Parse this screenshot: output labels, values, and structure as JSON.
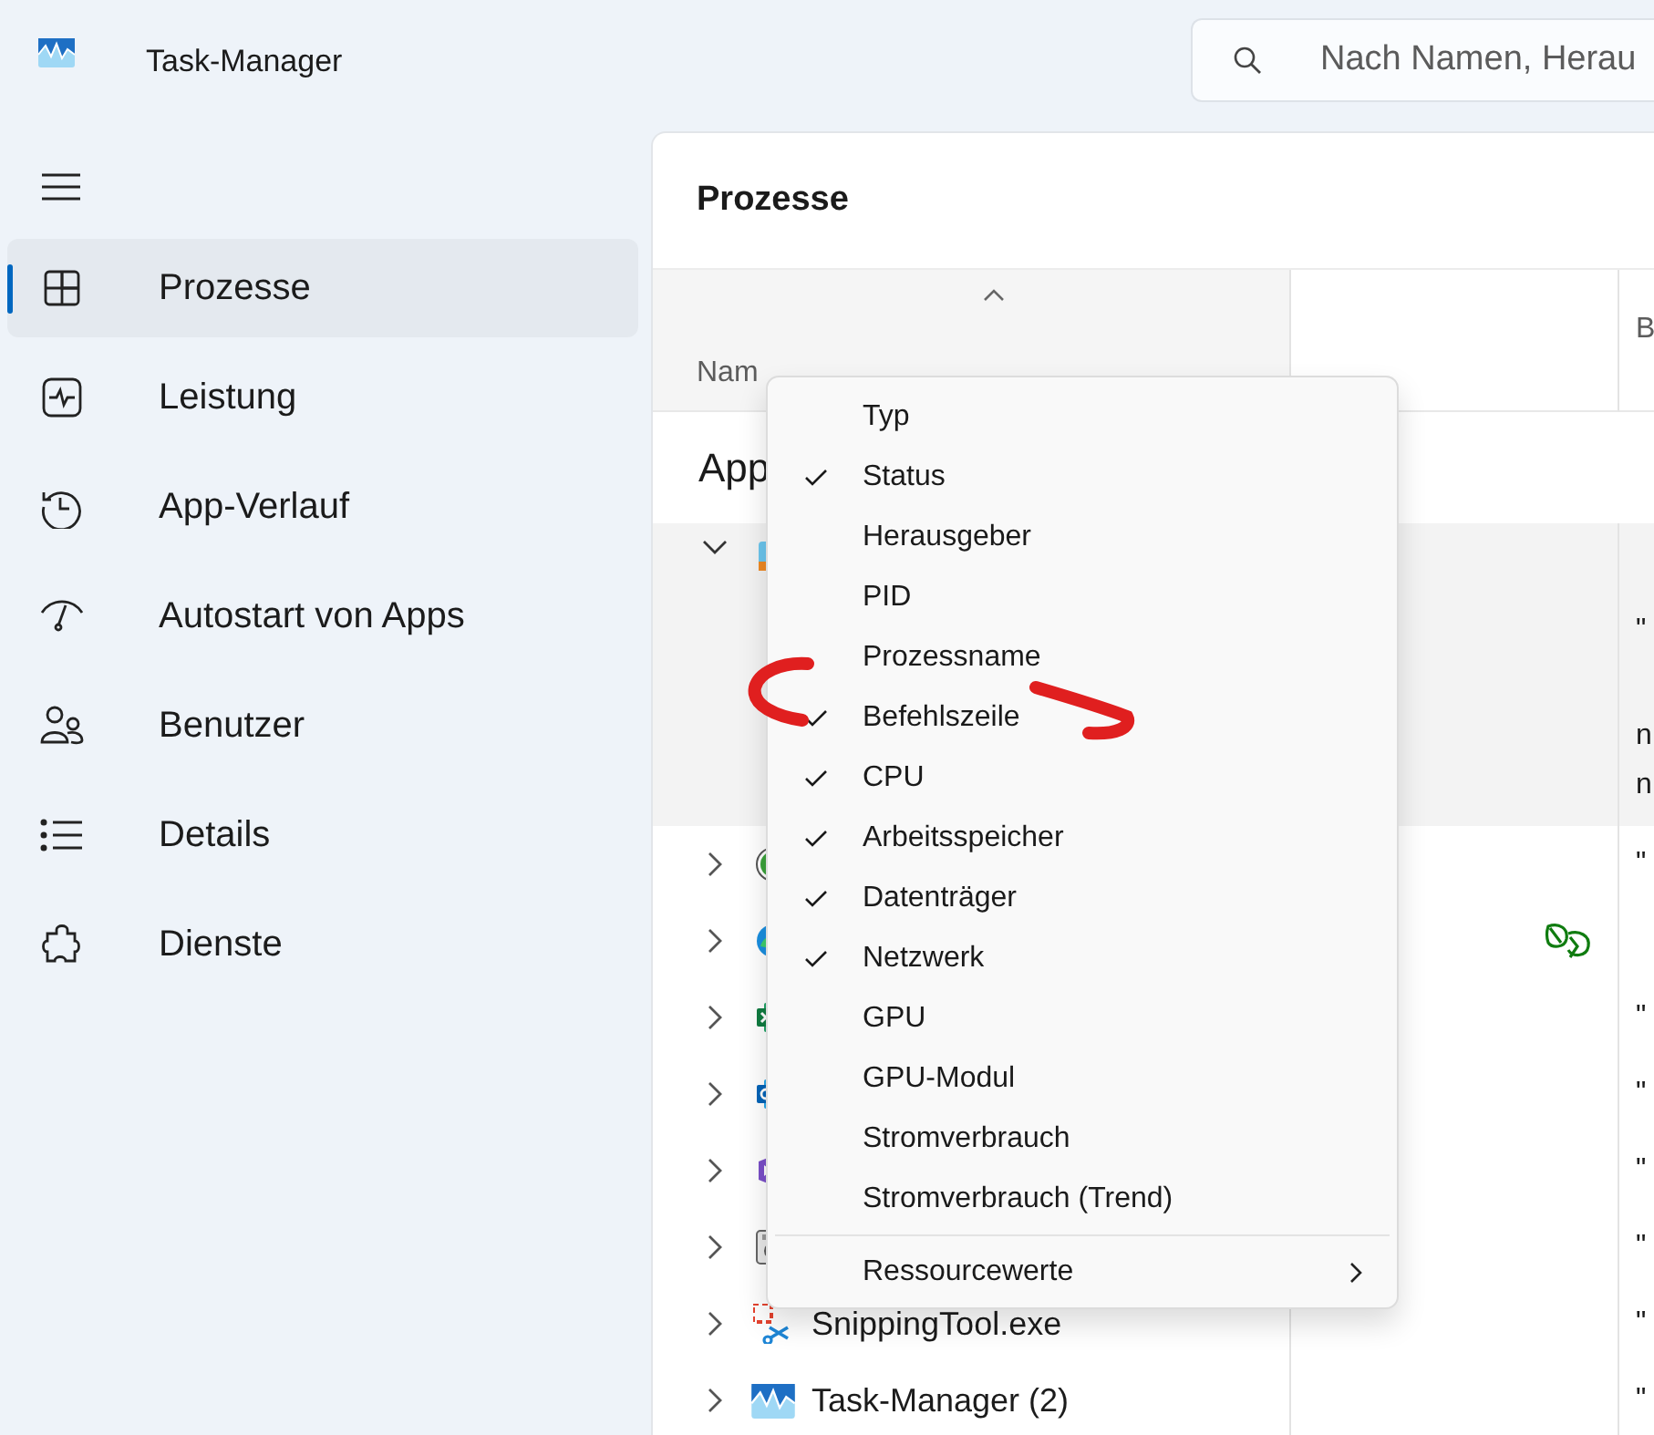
{
  "window": {
    "title": "Task-Manager"
  },
  "search": {
    "placeholder": "Nach Namen, Herau"
  },
  "sidebar": {
    "items": [
      {
        "label": "Prozesse",
        "selected": true
      },
      {
        "label": "Leistung",
        "selected": false
      },
      {
        "label": "App-Verlauf",
        "selected": false
      },
      {
        "label": "Autostart von Apps",
        "selected": false
      },
      {
        "label": "Benutzer",
        "selected": false
      },
      {
        "label": "Details",
        "selected": false
      },
      {
        "label": "Dienste",
        "selected": false
      }
    ]
  },
  "panel": {
    "title": "Prozesse"
  },
  "table": {
    "columns": {
      "name": {
        "label": "Nam",
        "sorted": true
      },
      "column_3": {
        "label": "B"
      }
    },
    "group": {
      "label": "App"
    },
    "rows": [
      {
        "expanded": true,
        "efficiency_mode": false,
        "column_3": [
          "\"",
          "n",
          "n"
        ]
      },
      {
        "expanded": false,
        "efficiency_mode": false,
        "column_3": [
          "\""
        ]
      },
      {
        "expanded": false,
        "efficiency_mode": true
      },
      {
        "expanded": false,
        "efficiency_mode": false,
        "column_3": [
          "\""
        ]
      },
      {
        "expanded": false,
        "efficiency_mode": false,
        "column_3": [
          "\""
        ]
      },
      {
        "expanded": false,
        "efficiency_mode": false,
        "column_3": [
          "\""
        ]
      },
      {
        "expanded": false,
        "efficiency_mode": false,
        "column_3": [
          "\""
        ]
      },
      {
        "expanded": false,
        "efficiency_mode": false,
        "name": "SnippingTool.exe",
        "column_3": [
          "\""
        ]
      },
      {
        "expanded": false,
        "efficiency_mode": false,
        "name": "Task-Manager (2)",
        "column_3": [
          "\""
        ]
      }
    ]
  },
  "context_menu": {
    "items": [
      {
        "label": "Typ",
        "checked": false
      },
      {
        "label": "Status",
        "checked": true
      },
      {
        "label": "Herausgeber",
        "checked": false
      },
      {
        "label": "PID",
        "checked": false
      },
      {
        "label": "Prozessname",
        "checked": false
      },
      {
        "label": "Befehlszeile",
        "checked": true
      },
      {
        "label": "CPU",
        "checked": true
      },
      {
        "label": "Arbeitsspeicher",
        "checked": true
      },
      {
        "label": "Datenträger",
        "checked": true
      },
      {
        "label": "Netzwerk",
        "checked": true
      },
      {
        "label": "GPU",
        "checked": false
      },
      {
        "label": "GPU-Modul",
        "checked": false
      },
      {
        "label": "Stromverbrauch",
        "checked": false
      },
      {
        "label": "Stromverbrauch (Trend)",
        "checked": false
      }
    ],
    "submenu": {
      "label": "Ressourcewerte"
    }
  }
}
